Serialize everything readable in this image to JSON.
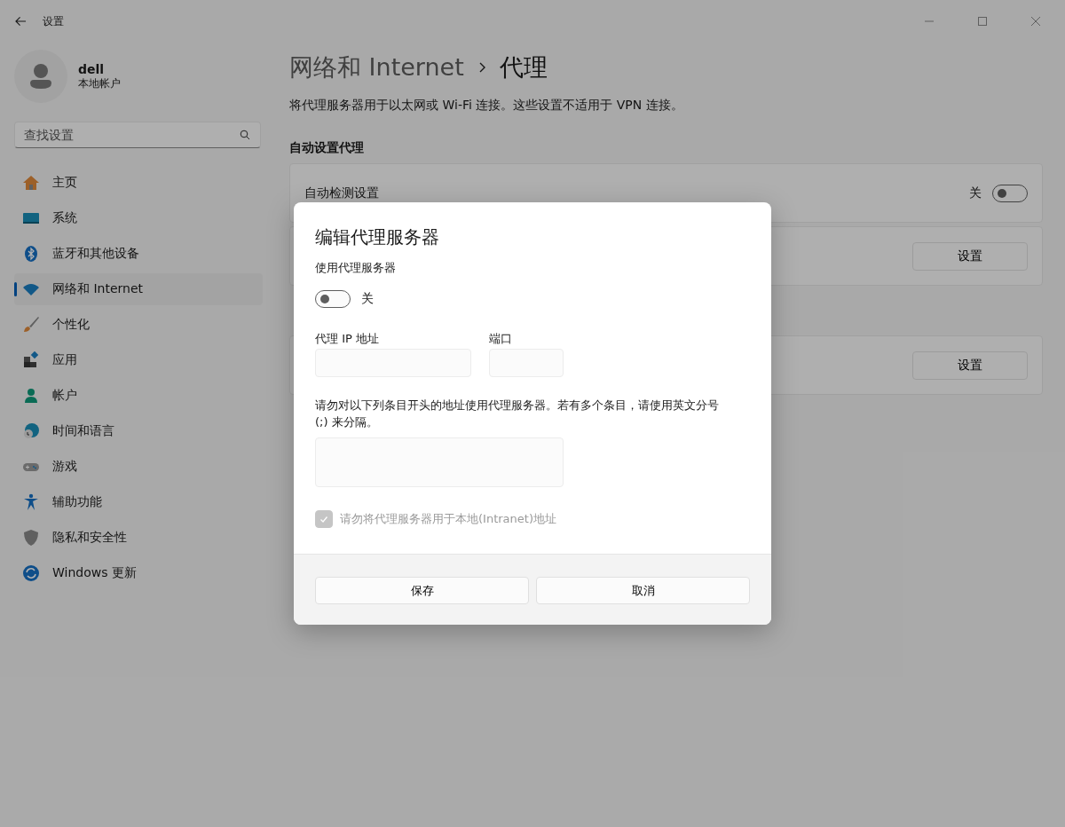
{
  "window": {
    "title": "设置"
  },
  "account": {
    "name": "dell",
    "type": "本地帐户"
  },
  "search": {
    "placeholder": "查找设置"
  },
  "nav": [
    {
      "label": "主页",
      "kind": "home",
      "selected": false
    },
    {
      "label": "系统",
      "kind": "system",
      "selected": false
    },
    {
      "label": "蓝牙和其他设备",
      "kind": "bluetooth",
      "selected": false
    },
    {
      "label": "网络和 Internet",
      "kind": "network",
      "selected": true
    },
    {
      "label": "个性化",
      "kind": "brush",
      "selected": false
    },
    {
      "label": "应用",
      "kind": "apps",
      "selected": false
    },
    {
      "label": "帐户",
      "kind": "account",
      "selected": false
    },
    {
      "label": "时间和语言",
      "kind": "time",
      "selected": false
    },
    {
      "label": "游戏",
      "kind": "gaming",
      "selected": false
    },
    {
      "label": "辅助功能",
      "kind": "accessibility",
      "selected": false
    },
    {
      "label": "隐私和安全性",
      "kind": "privacy",
      "selected": false
    },
    {
      "label": "Windows 更新",
      "kind": "update",
      "selected": false
    }
  ],
  "page": {
    "parent": "网络和 Internet",
    "title": "代理",
    "description": "将代理服务器用于以太网或 Wi-Fi 连接。这些设置不适用于 VPN 连接。"
  },
  "auto_section": {
    "heading": "自动设置代理",
    "detect_label": "自动检测设置",
    "detect_state": "关",
    "detect_on": false,
    "script_button": "设置"
  },
  "manual_section": {
    "setup_button": "设置"
  },
  "dialog": {
    "title": "编辑代理服务器",
    "use_proxy_label": "使用代理服务器",
    "use_proxy_on": false,
    "use_proxy_state": "关",
    "ip_label": "代理 IP 地址",
    "port_label": "端口",
    "exceptions_text": "请勿对以下列条目开头的地址使用代理服务器。若有多个条目，请使用英文分号 (;) 来分隔。",
    "local_checkbox": {
      "label": "请勿将代理服务器用于本地(Intranet)地址",
      "checked": true,
      "disabled": true
    },
    "buttons": [
      "保存",
      "取消"
    ]
  }
}
